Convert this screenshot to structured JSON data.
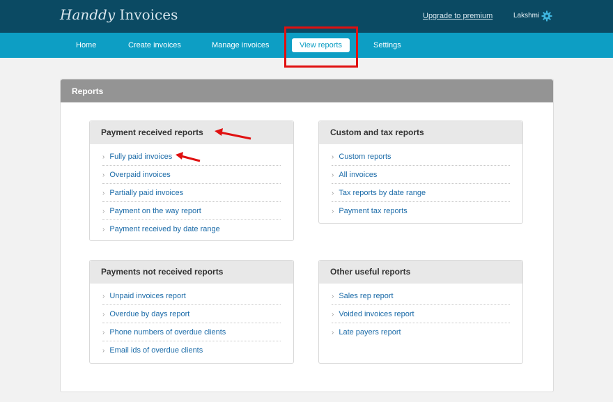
{
  "header": {
    "logo_script": "Handdy",
    "logo_text": " Invoices",
    "upgrade_link": "Upgrade to premium",
    "user_name": "Lakshmi"
  },
  "nav": {
    "items": [
      {
        "label": "Home"
      },
      {
        "label": "Create invoices"
      },
      {
        "label": "Manage invoices"
      },
      {
        "label": "View reports",
        "active": true
      },
      {
        "label": "Settings"
      }
    ]
  },
  "panel": {
    "title": "Reports"
  },
  "cards": [
    {
      "title": "Payment received reports",
      "items": [
        "Fully paid invoices",
        "Overpaid invoices",
        "Partially paid invoices",
        "Payment on the way report",
        "Payment received by date range"
      ]
    },
    {
      "title": "Custom and tax reports",
      "items": [
        "Custom reports",
        "All invoices",
        "Tax reports by date range",
        "Payment tax reports"
      ]
    },
    {
      "title": "Payments not received reports",
      "items": [
        "Unpaid invoices report",
        "Overdue by days report",
        "Phone numbers of overdue clients",
        "Email ids of overdue clients"
      ]
    },
    {
      "title": "Other useful reports",
      "items": [
        "Sales rep report",
        "Voided invoices report",
        "Late payers report"
      ]
    }
  ],
  "colors": {
    "header_bg": "#0b4a63",
    "nav_bg": "#0d9ec4",
    "panel_head_bg": "#949494",
    "link": "#1b6ba8",
    "annotation_red": "#e01010"
  },
  "icons": {
    "settings": "gear-icon",
    "bullet": "chevron-right-icon",
    "annotation": "red-arrow-icon"
  }
}
